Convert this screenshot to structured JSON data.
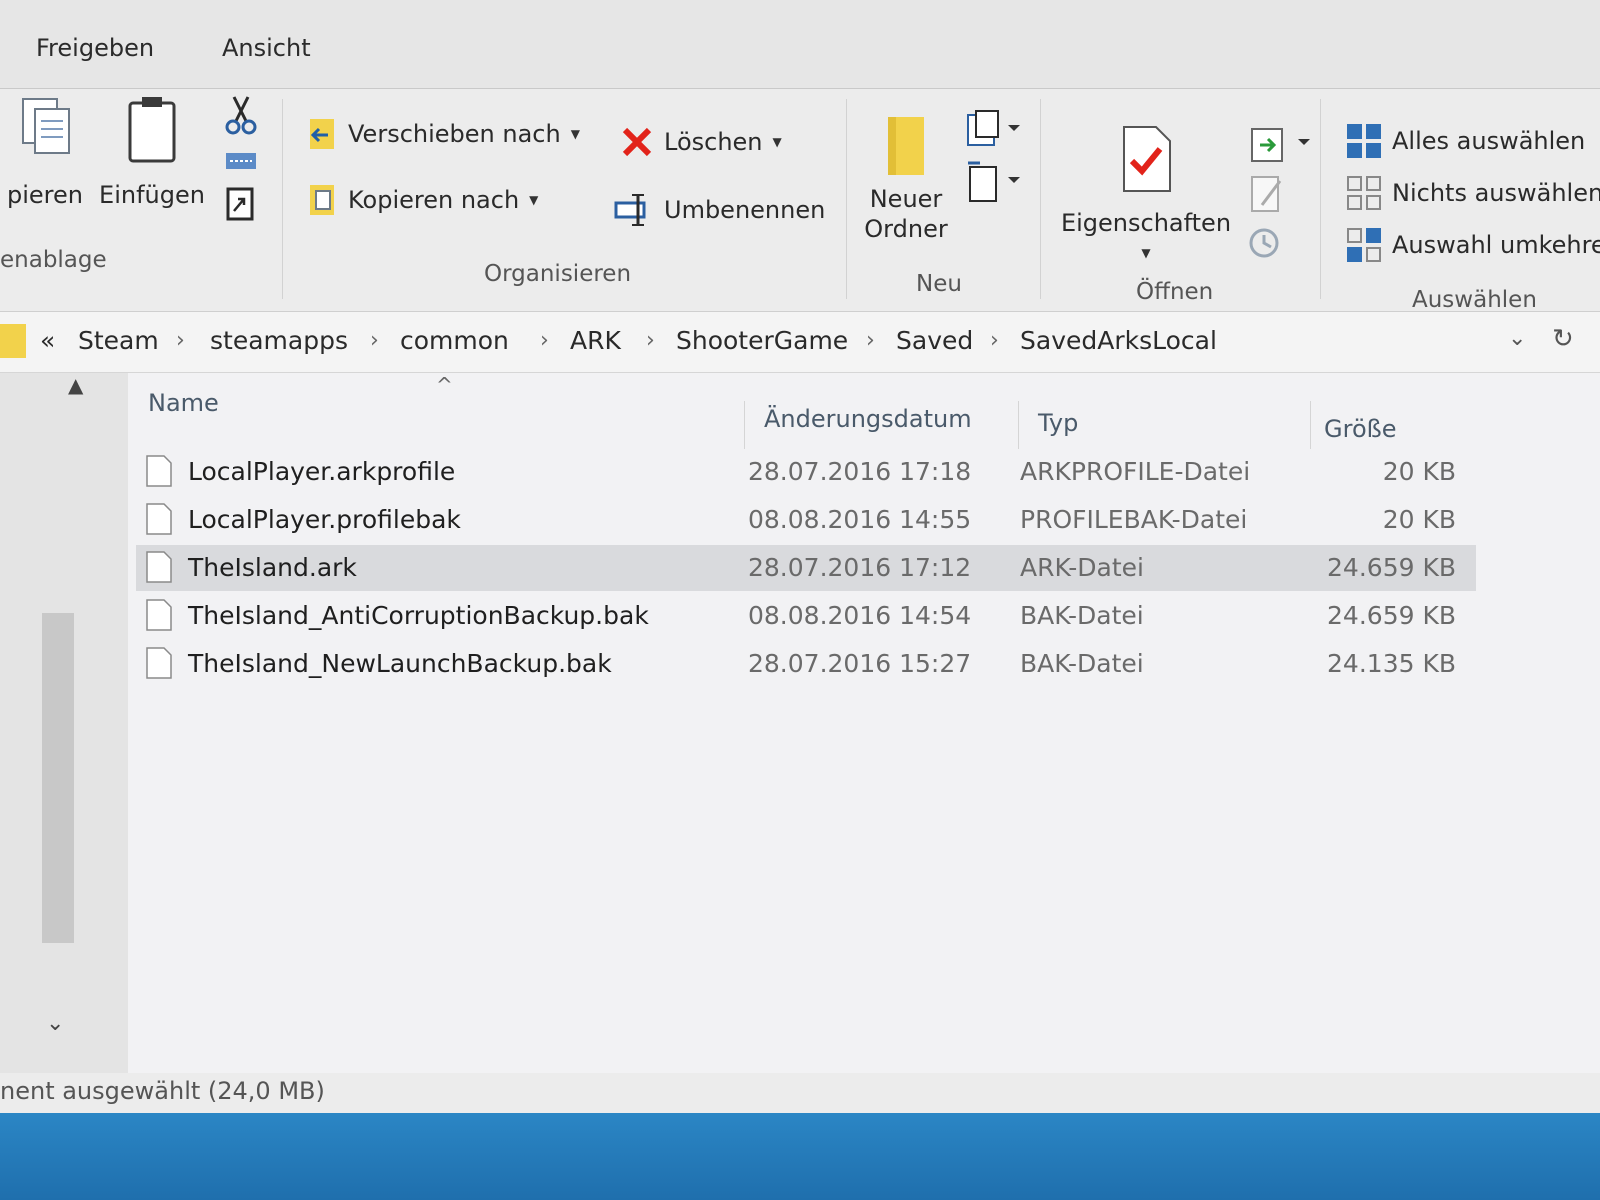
{
  "ribbon_tabs": [
    "Freigeben",
    "Ansicht"
  ],
  "clipboard": {
    "copy_label": "pieren",
    "paste_label": "Einfügen",
    "group_label": "enablage"
  },
  "organize": {
    "move_label": "Verschieben nach",
    "copy_to_label": "Kopieren nach",
    "delete_label": "Löschen",
    "rename_label": "Umbenennen",
    "group_label": "Organisieren"
  },
  "new_group": {
    "new_folder_line1": "Neuer",
    "new_folder_line2": "Ordner",
    "group_label": "Neu"
  },
  "open_group": {
    "properties_label": "Eigenschaften",
    "group_label": "Öffnen"
  },
  "select_group": {
    "select_all": "Alles auswählen",
    "select_none": "Nichts auswählen",
    "invert": "Auswahl umkehre",
    "group_label": "Auswählen"
  },
  "breadcrumb": [
    "«",
    "Steam",
    "steamapps",
    "common",
    "ARK",
    "ShooterGame",
    "Saved",
    "SavedArksLocal"
  ],
  "columns": {
    "name": "Name",
    "date": "Änderungsdatum",
    "type": "Typ",
    "size": "Größe"
  },
  "files": [
    {
      "name": "LocalPlayer.arkprofile",
      "date": "28.07.2016 17:18",
      "type": "ARKPROFILE-Datei",
      "size": "20 KB"
    },
    {
      "name": "LocalPlayer.profilebak",
      "date": "08.08.2016 14:55",
      "type": "PROFILEBAK-Datei",
      "size": "20 KB"
    },
    {
      "name": "TheIsland.ark",
      "date": "28.07.2016 17:12",
      "type": "ARK-Datei",
      "size": "24.659 KB"
    },
    {
      "name": "TheIsland_AntiCorruptionBackup.bak",
      "date": "08.08.2016 14:54",
      "type": "BAK-Datei",
      "size": "24.659 KB"
    },
    {
      "name": "TheIsland_NewLaunchBackup.bak",
      "date": "28.07.2016 15:27",
      "type": "BAK-Datei",
      "size": "24.135 KB"
    }
  ],
  "selected_row": 2,
  "status_text": "nent ausgewählt (24,0 MB)",
  "colors": {
    "delete_red": "#e2231a",
    "folder_yellow": "#f2d24b",
    "select_blue": "#2f6fb5",
    "taskbar": "#2b86c5"
  }
}
